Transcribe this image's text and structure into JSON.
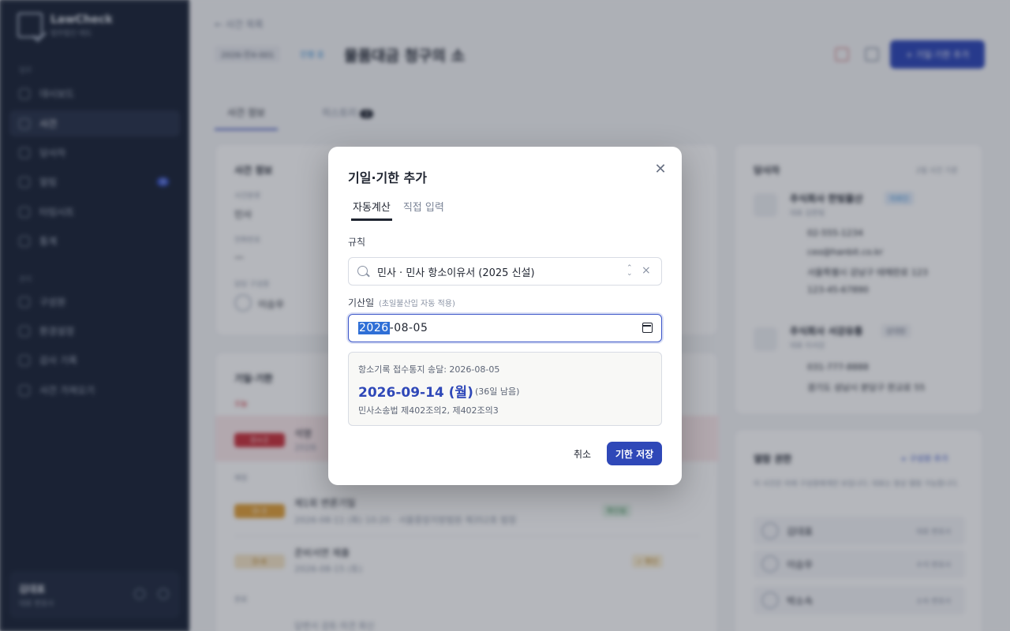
{
  "sidebar": {
    "brand": {
      "name": "LawCheck",
      "sub": "법무법인 태도"
    },
    "section_main": "업무",
    "section_admin": "관리",
    "items": [
      {
        "label": "대시보드"
      },
      {
        "label": "사건"
      },
      {
        "label": "당사자"
      },
      {
        "label": "알림",
        "badge": "3"
      },
      {
        "label": "타임시트"
      },
      {
        "label": "통계"
      },
      {
        "label": "구성원"
      },
      {
        "label": "환경설정"
      },
      {
        "label": "감사 기록"
      },
      {
        "label": "사건 가져오기"
      }
    ],
    "user": {
      "name": "김대표",
      "role": "대표 변호사"
    }
  },
  "header": {
    "back_label": "← 사건 목록",
    "case_no": "2026-민4-001",
    "status": "진행 중",
    "title": "물품대금 청구의 소",
    "add_button": "+ 기일·기한 추가"
  },
  "tabs": [
    {
      "label": "사건 정보"
    },
    {
      "label": "히스토리",
      "badge": "4"
    }
  ],
  "case_info": {
    "title": "사건 정보",
    "field1_label": "사건분류",
    "field1_value": "민사",
    "field2_label": "전화번호",
    "field2_value": "—",
    "field3_label": "담당 구성원",
    "field3_value": "이승우"
  },
  "deadlines": {
    "title": "기일·기한",
    "group_overdue": "오늘",
    "group_upcoming": "예정",
    "group_done": "완료",
    "items": [
      {
        "dday": "D+2",
        "title": "석명",
        "meta": "2026"
      },
      {
        "dday": "D-3",
        "title": "제1회 변론기일",
        "meta": "2026-08-11 (화) 10:20 · 서울중앙지방법원 제352호 법정",
        "tag": "확인됨"
      },
      {
        "dday": "D-6",
        "title": "준비서면 제출",
        "meta": "2026-08-15 (토)",
        "tag": "✓ 확인"
      },
      {
        "dday": "",
        "title": "답변서 검토·의견 회신",
        "meta": ""
      }
    ]
  },
  "parties": {
    "title": "당사자",
    "hint": "2일 사건 기준",
    "list": [
      {
        "name": "주식회사 한빛물산",
        "tag": "의뢰인",
        "rep": "대표 김한빛",
        "phone": "02-555-1234",
        "email": "ceo@hanbit.co.kr",
        "address": "서울특별시 강남구 테헤란로 123",
        "bizno": "123-45-67890"
      },
      {
        "name": "주식회사 서강유통",
        "tag": "상대방",
        "rep": "대표 이서강",
        "phone": "031-777-8888",
        "address": "경기도 성남시 분당구 판교로 55"
      }
    ]
  },
  "access": {
    "title": "열람 권한",
    "add": "+ 구성원 추가",
    "desc": "이 사건은 아래 구성원에게만 보입니다. 대표는 항상 열람 가능합니다.",
    "members": [
      {
        "name": "김대표",
        "role": "대표 변호사"
      },
      {
        "name": "이승우",
        "role": "수석 변호사"
      },
      {
        "name": "박소속",
        "role": "소속 변호사"
      }
    ]
  },
  "modal": {
    "title": "기일·기한 추가",
    "tab_auto": "자동계산",
    "tab_manual": "직접 입력",
    "rule_label": "규칙",
    "rule_value": "민사 · 민사 항소이유서 (2025 신설)",
    "base_label": "기산일",
    "base_hint": "(초일불산입 자동 적용)",
    "date_year": "2026",
    "date_rest": "-08-05",
    "result_basis": "항소기록 접수통지 송달: 2026-08-05",
    "result_date": "2026-09-14 (월)",
    "result_remaining": "(36일 남음)",
    "result_law": "민사소송법 제402조의2, 제402조의3",
    "cancel": "취소",
    "save": "기한 저장"
  },
  "colors": {
    "primary": "#2f48b8",
    "sidebar": "#1b2437",
    "danger": "#c9333d",
    "warning": "#e0a03a"
  }
}
